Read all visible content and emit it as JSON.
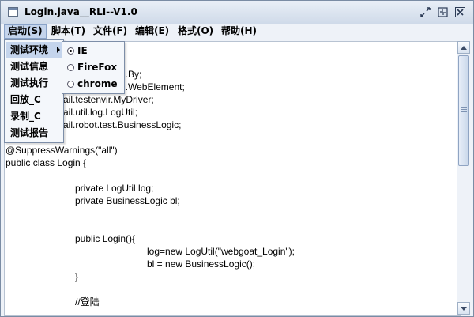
{
  "window": {
    "title": "Login.java__RLI--V1.0"
  },
  "menubar": {
    "items": [
      {
        "label": "启动(S)"
      },
      {
        "label": "脚本(T)"
      },
      {
        "label": "文件(F)"
      },
      {
        "label": "编辑(E)"
      },
      {
        "label": "格式(O)"
      },
      {
        "label": "帮助(H)"
      }
    ]
  },
  "dropdown": {
    "items": [
      {
        "label": "测试环境"
      },
      {
        "label": "测试信息"
      },
      {
        "label": "测试执行"
      },
      {
        "label": "回放_C"
      },
      {
        "label": "录制_C"
      },
      {
        "label": "测试报告"
      }
    ]
  },
  "submenu": {
    "items": [
      {
        "label": "IE",
        "checked": true
      },
      {
        "label": "FireFox",
        "checked": false
      },
      {
        "label": "chrome",
        "checked": false
      }
    ]
  },
  "editor": {
    "lines": [
      "n.By;",
      "n.WebElement;",
      "ail.testenvir.MyDriver;",
      "ail.util.log.LogUtil;",
      "ail.robot.test.BusinessLogic;",
      "@SuppressWarnings(\"all\")",
      "public class Login {",
      "private LogUtil log;",
      "private BusinessLogic bl;",
      "public Login(){",
      "log=new LogUtil(\"webgoat_Login\");",
      "bl = new BusinessLogic();",
      "}",
      "//登陆"
    ]
  },
  "icons": {
    "window": "window-icon",
    "restore": "restore-icon",
    "maximize": "maximize-icon",
    "close": "close-icon",
    "submenu_arrow": "triangle-right-icon",
    "radio": "radio-icon",
    "scroll_up": "arrow-up-icon",
    "scroll_down": "arrow-down-icon"
  }
}
